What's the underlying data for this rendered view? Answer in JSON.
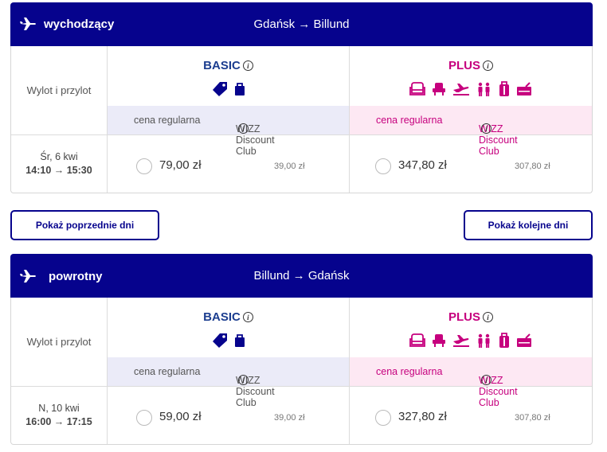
{
  "outbound": {
    "direction_label": "wychodzący",
    "route": "Gdańsk → Billund",
    "row_label": "Wylot i przylot",
    "basic_title": "BASIC",
    "plus_title": "PLUS",
    "basic_regular_label": "cena regularna",
    "basic_club_label": "WIZZ Discount Club",
    "plus_regular_label": "cena regularna",
    "plus_club_label": "WIZZ Discount Club",
    "date": "Śr, 6 kwi",
    "times": "14:10 → 15:30",
    "basic_price": "79,00 zł",
    "basic_club_price": "39,00 zł",
    "plus_price": "347,80 zł",
    "plus_club_price": "307,80 zł"
  },
  "nav": {
    "prev_label": "Pokaż poprzednie dni",
    "next_label": "Pokaż kolejne dni"
  },
  "return": {
    "direction_label": "powrotny",
    "route": "Billund → Gdańsk",
    "row_label": "Wylot i przylot",
    "basic_title": "BASIC",
    "plus_title": "PLUS",
    "basic_regular_label": "cena regularna",
    "basic_club_label": "WIZZ Discount Club",
    "plus_regular_label": "cena regularna",
    "plus_club_label": "WIZZ Discount Club",
    "date": "N, 10 kwi",
    "times": "16:00 → 17:15",
    "basic_price": "59,00 zł",
    "basic_club_price": "39,00 zł",
    "plus_price": "327,80 zł",
    "plus_club_price": "307,80 zł"
  },
  "colors": {
    "header_bg": "#06038d",
    "basic": "#1b3d8f",
    "plus": "#c6007e",
    "basic_sub_bg": "#ebebf8",
    "plus_sub_bg": "#fde8f3"
  },
  "icons": {
    "basic": [
      "price-tag-icon",
      "small-bag-icon"
    ],
    "plus": [
      "seat-icon",
      "seat-selection-icon",
      "priority-boarding-icon",
      "check-in-icon",
      "trolley-bag-icon",
      "checked-bag-icon"
    ]
  }
}
